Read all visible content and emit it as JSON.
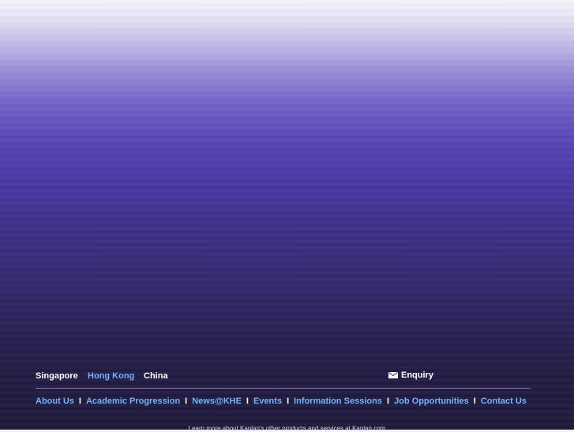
{
  "regions": [
    {
      "label": "Singapore",
      "active": false
    },
    {
      "label": "Hong Kong",
      "active": true
    },
    {
      "label": "China",
      "active": false
    }
  ],
  "enquiry": {
    "label": "Enquiry",
    "icon": "mail-icon"
  },
  "nav_links": [
    "About Us",
    "Academic Progression",
    "News@KHE",
    "Events",
    "Information Sessions",
    "Job Opportunities",
    "Contact Us"
  ],
  "separator": "I",
  "tagline": "Learn more about Kaplan's other products and services at Kaplan.com",
  "colors": {
    "link_accent": "#6fb6ff",
    "text_white": "#ffffff",
    "background_top": "#f4f3fb",
    "background_mid": "#5c48b8",
    "background_bottom": "#1f1a3a"
  }
}
